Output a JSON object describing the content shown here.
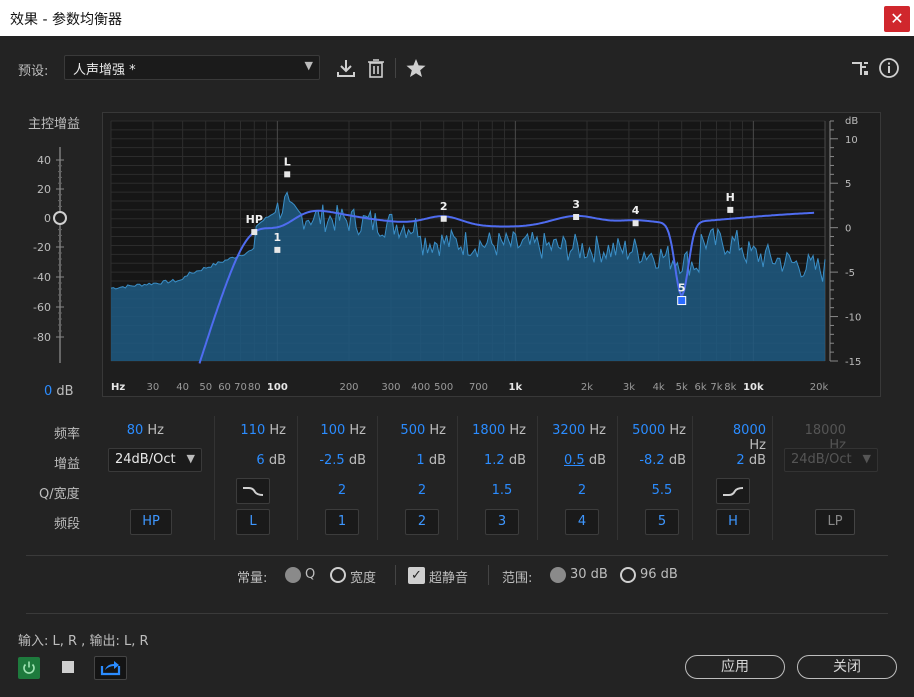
{
  "window": {
    "title": "效果 - 参数均衡器",
    "close_glyph": "✕"
  },
  "preset": {
    "label": "预设:",
    "value": "人声增强 *",
    "icons": [
      "download-icon",
      "trash-icon",
      "star-icon",
      "routing-icon",
      "info-icon"
    ]
  },
  "master": {
    "label": "主控增益",
    "ticks": [
      "40",
      "20",
      "0",
      "-20",
      "-40",
      "-60",
      "-80"
    ],
    "value_num": "0",
    "value_unit": "dB"
  },
  "graph": {
    "x_labels": [
      "Hz",
      "30",
      "40",
      "50",
      "60",
      "70",
      "80",
      "100",
      "200",
      "300",
      "400",
      "500",
      "700",
      "1k",
      "2k",
      "3k",
      "4k",
      "5k",
      "6k",
      "7k",
      "8k",
      "10k",
      "20k"
    ],
    "right_unit": "dB",
    "right_ticks": [
      "10",
      "5",
      "0",
      "-5",
      "-10",
      "-15"
    ],
    "markers": [
      {
        "label": "HP",
        "freq": 80
      },
      {
        "label": "L",
        "freq": 110
      },
      {
        "label": "1",
        "freq": 100
      },
      {
        "label": "2",
        "freq": 500
      },
      {
        "label": "3",
        "freq": 1800
      },
      {
        "label": "4",
        "freq": 3200
      },
      {
        "label": "5",
        "freq": 5000
      },
      {
        "label": "H",
        "freq": 8000
      }
    ],
    "colors": {
      "spectrum_fill": "#1e5a82",
      "spectrum_line": "#3b8fc7",
      "curve": "#4f6cf0",
      "marker": "#e8e8e8"
    }
  },
  "params": {
    "row_labels": {
      "freq": "频率",
      "gain": "增益",
      "q": "Q/宽度",
      "band": "频段"
    },
    "hp": {
      "freq": "80",
      "unit": "Hz",
      "slope": "24dB/Oct",
      "band": "HP"
    },
    "l": {
      "freq": "110",
      "unit": "Hz",
      "gain": "6",
      "gain_unit": "dB",
      "band": "L"
    },
    "bands": [
      {
        "freq": "100",
        "gain": "-2.5",
        "q": "2",
        "band": "1"
      },
      {
        "freq": "500",
        "gain": "1",
        "q": "2",
        "band": "2"
      },
      {
        "freq": "1800",
        "gain": "1.2",
        "q": "1.5",
        "band": "3"
      },
      {
        "freq": "3200",
        "gain": "0.5",
        "q": "2",
        "band": "4"
      },
      {
        "freq": "5000",
        "gain": "-8.2",
        "q": "5.5",
        "band": "5"
      }
    ],
    "h": {
      "freq": "8000",
      "unit": "Hz",
      "gain": "2",
      "gain_unit": "dB",
      "band": "H"
    },
    "lp": {
      "freq": "18000",
      "unit": "Hz",
      "slope": "24dB/Oct",
      "band": "LP"
    },
    "hz": "Hz",
    "db": "dB"
  },
  "options": {
    "constant_label": "常量:",
    "q_label": "Q",
    "width_label": "宽度",
    "ultra_quiet_label": "超静音",
    "ultra_quiet_checked": true,
    "range_label": "范围:",
    "range_30": "30 dB",
    "range_96": "96 dB"
  },
  "footer": {
    "io": "输入: L, R , 输出: L, R",
    "apply": "应用",
    "close": "关闭"
  }
}
